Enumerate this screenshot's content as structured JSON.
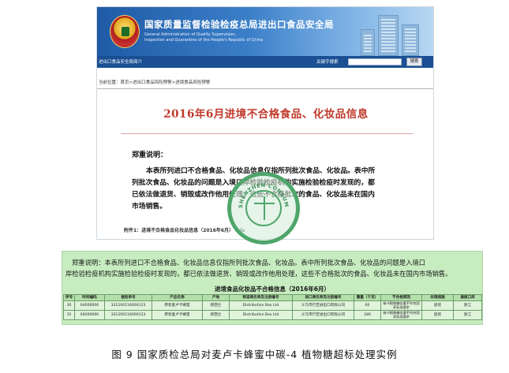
{
  "header": {
    "title": "国家质量监督检验检疫总局进出口食品安全局",
    "subtitle_en_1": "General Administration of Quality Supervision,",
    "subtitle_en_2": "Inspection and Quarantine of the People's Republic of China"
  },
  "nav": {
    "link": "进出口食品安全局简介",
    "search_label": "关键字搜索",
    "search_value": "",
    "search_button": "搜索"
  },
  "breadcrumb": "当前位置：首页>进出口食品风险预警>进境食品风险预警",
  "document": {
    "title": "2016年6月进境不合格食品、化妆品信息",
    "notice_heading": "郑重说明：",
    "notice_lines": [
      "本表所列进口不合格食品、化妆品信息仅指所列批次食品、化妆品。表中所",
      "列批次食品、化妆品的问题是入境口岸检验检疫机构实施检验检疫时发现的，都",
      "已依法做退货、销毁或改作他用处理；这些不合格批次的食品、化妆品未在国内",
      "市场销售。"
    ],
    "attachment": "附件1：进境不合格食品化妆品信息（2016年6月）  .xls"
  },
  "seal": {
    "ring_text": "SHENZHEN CONSUMER COUNCIL"
  },
  "panel": {
    "line_1": "郑重说明：本表所列进口不合格食品、化妆品信息仅指所列批次食品、化妆品。表中所列批次食品、化妆品的问题是入境口",
    "line_2": "岸检验检疫机构实施检验检疫时发现的，都已依法做退货、销毁或改作他用处理，这些不合格批次的食品、化妆品未在国内市场销售。",
    "table_title": "进境食品化妆品不合格信息（2016年6月）",
    "columns": [
      "序号",
      "时间编码",
      "报检单号",
      "产品名称",
      "产地",
      "制造商名称及注册编号",
      "进口商名称及注册编号",
      "重量（千克）",
      "不合格原因",
      "处理措施",
      "通报口岸"
    ],
    "rows": [
      [
        "30",
        "04000000",
        "331200116000123",
        "原装麦卢卡蜂蜜",
        "新西兰",
        "Distribution Box Ltd",
        "义乌市行吉进出口有限公司",
        "60",
        "碳-4植物糖含量不符合国家标准要求",
        "退货",
        "浙江"
      ],
      [
        "31",
        "04000000",
        "331200116000123",
        "原装麦卢卡蜂蜜",
        "新西兰",
        "Distribution Box Ltd",
        "义乌市行吉进出口有限公司",
        "180",
        "碳-4植物糖含量不符合国家标准要求",
        "退货",
        "浙江"
      ]
    ]
  },
  "caption": "图 9  国家质检总局对麦卢卡蜂蜜中碳-4 植物糖超标处理实例"
}
